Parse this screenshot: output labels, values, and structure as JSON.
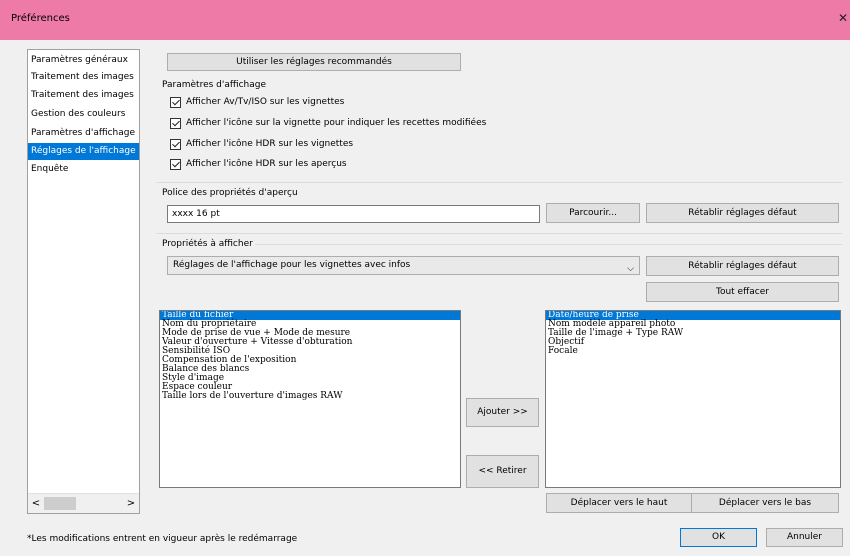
{
  "window": {
    "title": "Préférences",
    "close_glyph": "✕"
  },
  "sidebar": {
    "items": [
      {
        "label": "Paramètres généraux",
        "selected": false
      },
      {
        "label": "Traitement des images",
        "selected": false
      },
      {
        "label": "Traitement des images",
        "selected": false
      },
      {
        "label": "Gestion des couleurs",
        "selected": false
      },
      {
        "label": "Paramètres d'affichage",
        "selected": false
      },
      {
        "label": "Réglages de l'affichage",
        "selected": true
      },
      {
        "label": "Enquête",
        "selected": false
      }
    ],
    "scroll_left": "<",
    "scroll_right": ">"
  },
  "recommended_button": "Utiliser les réglages recommandés",
  "display_params": {
    "title": "Paramètres d'affichage",
    "checkboxes": [
      {
        "label": "Afficher Av/Tv/ISO sur les vignettes",
        "checked": true
      },
      {
        "label": "Afficher l'icône sur la vignette pour indiquer les recettes modifiées",
        "checked": true
      },
      {
        "label": "Afficher l'icône HDR sur les vignettes",
        "checked": true
      },
      {
        "label": "Afficher l'icône HDR sur les aperçus",
        "checked": true
      }
    ]
  },
  "font_section": {
    "title": "Police des propriétés d'aperçu",
    "value": "xxxx 16 pt",
    "browse_button": "Parcourir...",
    "reset_button": "Rétablir réglages défaut"
  },
  "props_section": {
    "title": "Propriétés à afficher",
    "dropdown_value": "Réglages de l'affichage pour les vignettes avec infos",
    "dropdown_arrow": "⌵",
    "reset_button": "Rétablir réglages défaut",
    "clear_button": "Tout effacer",
    "available": [
      {
        "label": "Taille du fichier",
        "selected": true
      },
      {
        "label": "Nom du propriétaire",
        "selected": false
      },
      {
        "label": "Mode de prise de vue + Mode de mesure",
        "selected": false
      },
      {
        "label": "Valeur d'ouverture + Vitesse d'obturation",
        "selected": false
      },
      {
        "label": "Sensibilité ISO",
        "selected": false
      },
      {
        "label": "Compensation de l'exposition",
        "selected": false
      },
      {
        "label": "Balance des blancs",
        "selected": false
      },
      {
        "label": "Style d'image",
        "selected": false
      },
      {
        "label": "Espace couleur",
        "selected": false
      },
      {
        "label": "Taille lors de l'ouverture d'images RAW",
        "selected": false
      }
    ],
    "add_button": "Ajouter >>",
    "remove_button": "<< Retirer",
    "selected_list": [
      {
        "label": "Date/heure de prise",
        "selected": true
      },
      {
        "label": "Nom modèle appareil photo",
        "selected": false
      },
      {
        "label": "Taille de l'image + Type RAW",
        "selected": false
      },
      {
        "label": "Objectif",
        "selected": false
      },
      {
        "label": "Focale",
        "selected": false
      }
    ],
    "move_up_button": "Déplacer vers le haut",
    "move_down_button": "Déplacer vers le bas"
  },
  "footer": {
    "note": "*Les modifications entrent en vigueur après le redémarrage",
    "ok_button": "OK",
    "cancel_button": "Annuler"
  }
}
